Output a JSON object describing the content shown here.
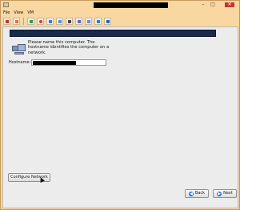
{
  "window": {
    "controls": {
      "minimize": "–",
      "maximize": "□",
      "close": "✕"
    }
  },
  "menu": [
    "File",
    "View",
    "VM"
  ],
  "toolbar": {
    "buttons": [
      {
        "name": "stop-icon",
        "color": "#c0392b"
      },
      {
        "name": "pause-icon",
        "color": "#e07a1f"
      },
      {
        "name": "play-icon",
        "color": "#2ea043"
      },
      {
        "name": "revert-icon",
        "color": "#d43f2f"
      },
      {
        "name": "snapshot-icon",
        "color": "#3a7bd5"
      },
      {
        "name": "snapshot-manager-icon",
        "color": "#5d8bd6"
      },
      {
        "name": "settings-icon",
        "color": "#4a4a4a"
      },
      {
        "name": "fullscreen-icon",
        "color": "#4f74b8"
      },
      {
        "name": "unity-icon",
        "color": "#6b8bd1"
      },
      {
        "name": "send-keys-icon",
        "color": "#3f78c2"
      },
      {
        "name": "console-icon",
        "color": "#2f5faa"
      }
    ]
  },
  "installer": {
    "description": "Please name this computer.  The hostname identifies the computer on a network.",
    "hostname_label": "Hostname:",
    "configure_button": "Configure Network",
    "back_button": "Back",
    "next_button": "Next"
  }
}
